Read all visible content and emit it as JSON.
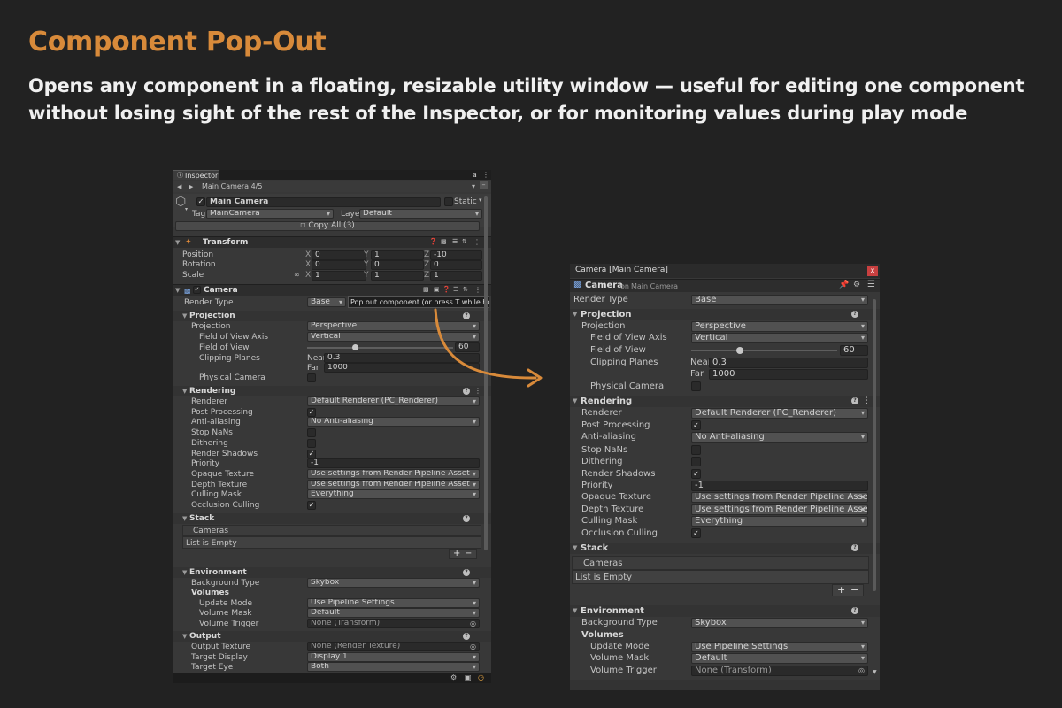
{
  "headline": "Component Pop-Out",
  "subline": "Opens any component in a floating, resizable utility window — useful for editing one component without losing sight of the rest of the Inspector, or for monitoring values during play mode",
  "colors": {
    "accent": "#d88a3a",
    "background": "#222222",
    "panel": "#383838",
    "header": "#2d2d2d"
  },
  "inspector": {
    "tab_label": "Inspector",
    "nav_title": "Main Camera  4/5",
    "object_name": "Main Camera",
    "static_label": "Static",
    "tag_label": "Tag",
    "tag_value": "MainCamera",
    "layer_label": "Layer",
    "layer_value": "Default",
    "copy_all": "Copy All (3)",
    "transform": {
      "title": "Transform",
      "position_label": "Position",
      "rotation_label": "Rotation",
      "scale_label": "Scale",
      "axis_x": "X",
      "axis_y": "Y",
      "axis_z": "Z",
      "position": [
        "0",
        "1",
        "-10"
      ],
      "rotation": [
        "0",
        "0",
        "0"
      ],
      "scale": [
        "1",
        "1",
        "1"
      ]
    },
    "camera_title": "Camera",
    "render_type_label": "Render Type",
    "render_type_value": "Base",
    "tooltip": "Pop out component  (or press T while hovering)",
    "projection_header": "Projection",
    "projection_label": "Projection",
    "projection_value": "Perspective",
    "fov_axis_label": "Field of View Axis",
    "fov_axis_value": "Vertical",
    "fov_label": "Field of View",
    "fov_value": "60",
    "clipping_label": "Clipping Planes",
    "near_label": "Near",
    "near_value": "0.3",
    "far_label": "Far",
    "far_value": "1000",
    "physical_label": "Physical Camera",
    "rendering_header": "Rendering",
    "renderer_label": "Renderer",
    "renderer_value": "Default Renderer (PC_Renderer)",
    "post_label": "Post Processing",
    "aa_label": "Anti-aliasing",
    "aa_value": "No Anti-aliasing",
    "nans_label": "Stop NaNs",
    "dither_label": "Dithering",
    "shadows_label": "Render Shadows",
    "priority_label": "Priority",
    "priority_value": "-1",
    "opaque_label": "Opaque Texture",
    "opaque_value": "Use settings from Render Pipeline Asset",
    "depth_label": "Depth Texture",
    "depth_value": "Use settings from Render Pipeline Asset",
    "culling_label": "Culling Mask",
    "culling_value": "Everything",
    "occlusion_label": "Occlusion Culling",
    "stack_header": "Stack",
    "cameras_label": "Cameras",
    "list_empty": "List is Empty",
    "plus": "+",
    "minus": "−",
    "environment_header": "Environment",
    "bg_type_label": "Background Type",
    "bg_type_value": "Skybox",
    "volumes_label": "Volumes",
    "update_mode_label": "Update Mode",
    "update_mode_value": "Use Pipeline Settings",
    "volume_mask_label": "Volume Mask",
    "volume_mask_value": "Default",
    "volume_trigger_label": "Volume Trigger",
    "volume_trigger_value": "None (Transform)",
    "output_header": "Output",
    "output_texture_label": "Output Texture",
    "output_texture_value": "None (Render Texture)",
    "target_display_label": "Target Display",
    "target_display_value": "Display 1",
    "target_eye_label": "Target Eye",
    "target_eye_value": "Both"
  },
  "popout": {
    "window_title": "Camera  [Main Camera]",
    "close": "x",
    "component": "Camera",
    "on_label": "on",
    "object": "Main Camera"
  }
}
